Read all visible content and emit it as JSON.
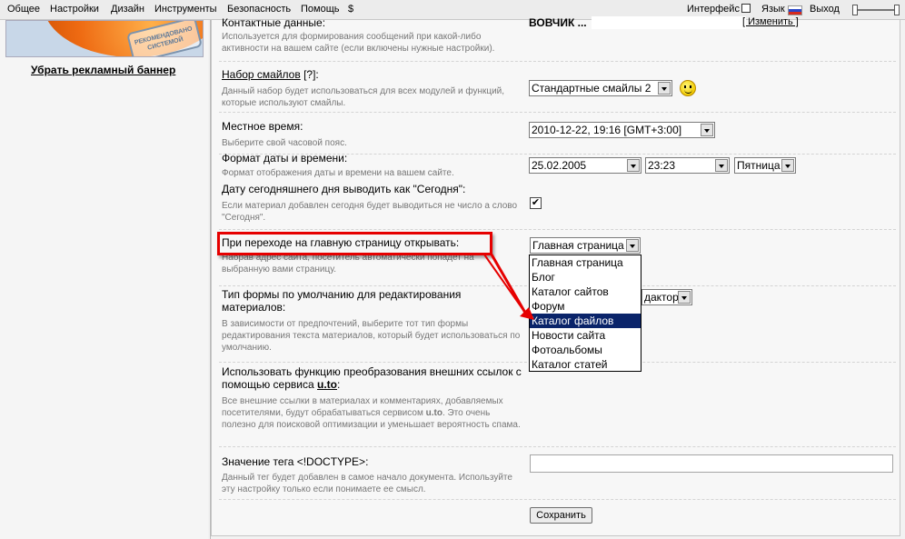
{
  "topbar": {
    "menu": [
      {
        "label": "Общее"
      },
      {
        "label": "Настройки"
      },
      {
        "label": "Дизайн"
      },
      {
        "label": "Инструменты"
      },
      {
        "label": "Безопасность"
      },
      {
        "label": "Помощь"
      },
      {
        "label": "$"
      }
    ],
    "interface_label": "Интерфейс",
    "language_label": "Язык",
    "exit_label": "Выход"
  },
  "left": {
    "banner_text": "РЕКОМЕНДОВАНО СИСТЕМОЙ",
    "remove_banner": "Убрать рекламный баннер"
  },
  "settings": {
    "contact": {
      "label": "Контактные данные:",
      "desc": "Используется для формирования сообщений при какой-либо активности на вашем сайте (если включены нужные настройки).",
      "value": "ВОВЧИК ...",
      "change_link": "[ Изменить ]"
    },
    "smiles": {
      "label": "Набор смайлов",
      "help": "[?]",
      "colon": ":",
      "desc": "Данный набор будет использоваться для всех модулей и функций, которые используют смайлы.",
      "value": "Стандартные смайлы 2"
    },
    "local_time": {
      "label": "Местное время:",
      "desc": "Выберите свой часовой пояс.",
      "value": "2010-12-22, 19:16 [GMT+3:00]"
    },
    "date_format": {
      "label": "Формат даты и времени:",
      "desc": "Формат отображения даты и времени на вашем сайте.",
      "date_value": "25.02.2005",
      "time_value": "23:23",
      "day_value": "Пятница"
    },
    "today": {
      "label": "Дату сегодняшнего дня выводить как \"Сегодня\":",
      "desc": "Если материал добавлен сегодня будет выводиться не число а слово \"Сегодня\".",
      "checked": "✔"
    },
    "homepage": {
      "label": "При переходе на главную страницу открывать:",
      "desc": "Набрав адрес сайта, посетитель автоматически попадет на выбранную вами страницу.",
      "value": "Главная страница",
      "options": [
        {
          "label": "Главная страница"
        },
        {
          "label": "Блог"
        },
        {
          "label": "Каталог сайтов"
        },
        {
          "label": "Форум"
        },
        {
          "label": "Каталог файлов"
        },
        {
          "label": "Новости сайта"
        },
        {
          "label": "Фотоальбомы"
        },
        {
          "label": "Каталог статей"
        }
      ],
      "highlighted_option": "Каталог файлов"
    },
    "editor": {
      "label_line1": "Тип формы по умолчанию для редактирования",
      "label_line2": "материалов:",
      "desc": "В зависимости от предпочтений, выберите тот тип формы редактирования текста материалов, который будет использоваться по умолчанию.",
      "value_fragment": "дактор"
    },
    "uto": {
      "label_line1": "Использовать функцию преобразования внешних ссылок с",
      "label_line2_prefix": "помощью сервиса ",
      "service": "u.to",
      "colon": ":",
      "desc_part1": "Все внешние ссылки в материалах и комментариях, добавляемых посетителями, будут обрабатываться сервисом ",
      "desc_service": "u.to",
      "desc_part2": ". Это очень полезно для поисковой оптимизации и уменьшает вероятность спама."
    },
    "doctype": {
      "label": "Значение тега <!DOCTYPE>:",
      "desc": "Данный тег будет добавлен в самое начало документа. Используйте эту настройку только если понимаете ее смысл.",
      "value": ""
    },
    "save_label": "Сохранить"
  },
  "colors": {
    "annotation_red": "#e60000",
    "selection_blue": "#0a246a"
  }
}
